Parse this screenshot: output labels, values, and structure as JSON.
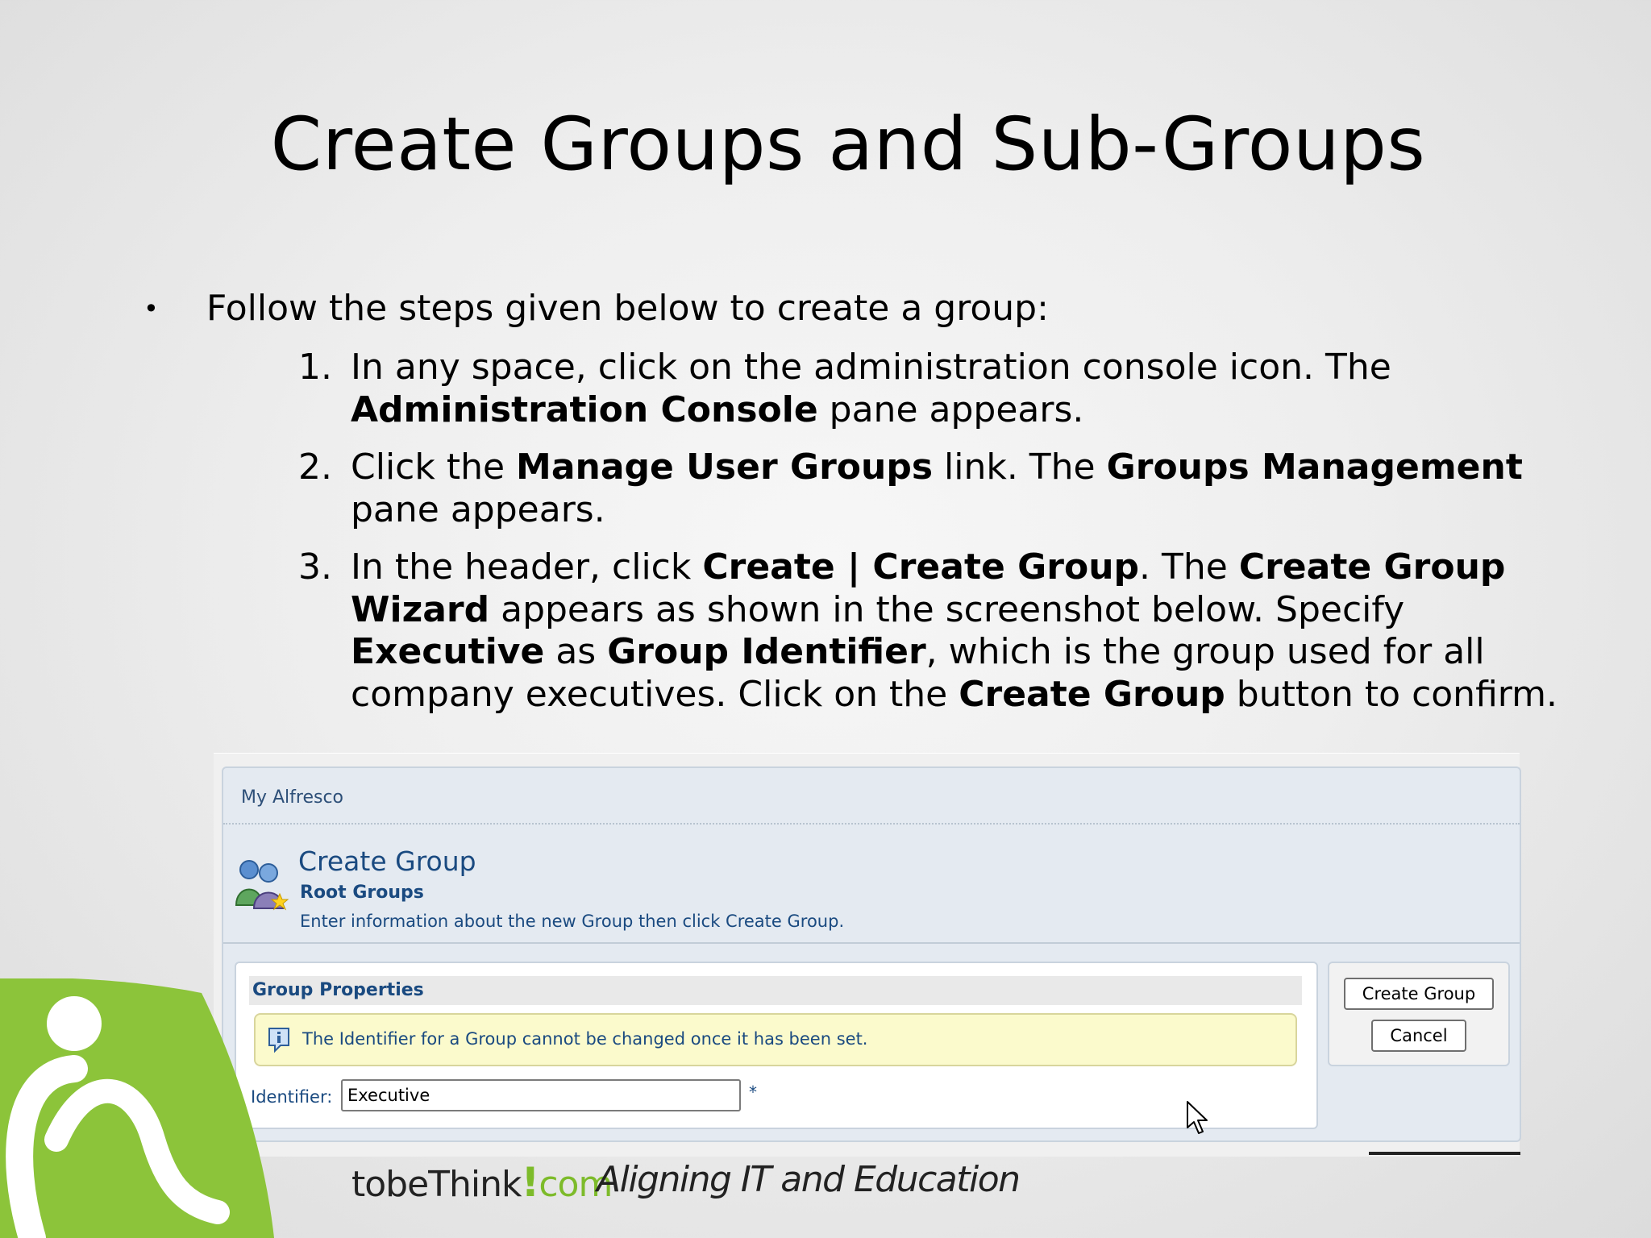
{
  "slide": {
    "title": "Create Groups and Sub-Groups",
    "bullet": {
      "symbol": "•",
      "text": "Follow the steps given below to create a group:"
    },
    "steps": [
      {
        "number": "1.",
        "t1": "In any space, click on the administration console icon. The ",
        "b1": "Administration Console",
        "t2": " pane appears."
      },
      {
        "number": "2.",
        "t1": "Click the ",
        "b1": "Manage User Groups",
        "t2": " link. The ",
        "b2": "Groups Management",
        "t3": " pane appears."
      },
      {
        "number": "3.",
        "t1": "In the header, click ",
        "b1": "Create | Create Group",
        "t2": ". The ",
        "b2": "Create Group Wizard",
        "t3": " appears as shown in the screenshot below. Specify ",
        "b3": "Executive",
        "t4": " as ",
        "b4": "Group Identifier",
        "t5": ", which is the group used for all company executives. Click on the ",
        "b5": "Create Group",
        "t6": " button to confirm."
      }
    ]
  },
  "screenshot": {
    "nav_label": "My Alfresco",
    "title": "Create Group",
    "subtitle": "Root Groups",
    "description": "Enter information about the new Group then click Create Group.",
    "section_title": "Group Properties",
    "info_message": "The Identifier for a Group cannot be changed once it has been set.",
    "identifier_label": "Identifier:",
    "identifier_value": "Executive",
    "required_marker": "*",
    "create_button": "Create Group",
    "cancel_button": "Cancel",
    "icons": {
      "group": "group-add-icon",
      "info": "info-icon",
      "cursor": "mouse-cursor-icon"
    }
  },
  "footer": {
    "brand_part1": "tobeThink",
    "brand_bang": "!",
    "brand_part2": "com",
    "tagline": "Aligning IT and Education",
    "colors": {
      "brand_green": "#7dbb2a",
      "logo_green": "#8cc43a"
    }
  }
}
